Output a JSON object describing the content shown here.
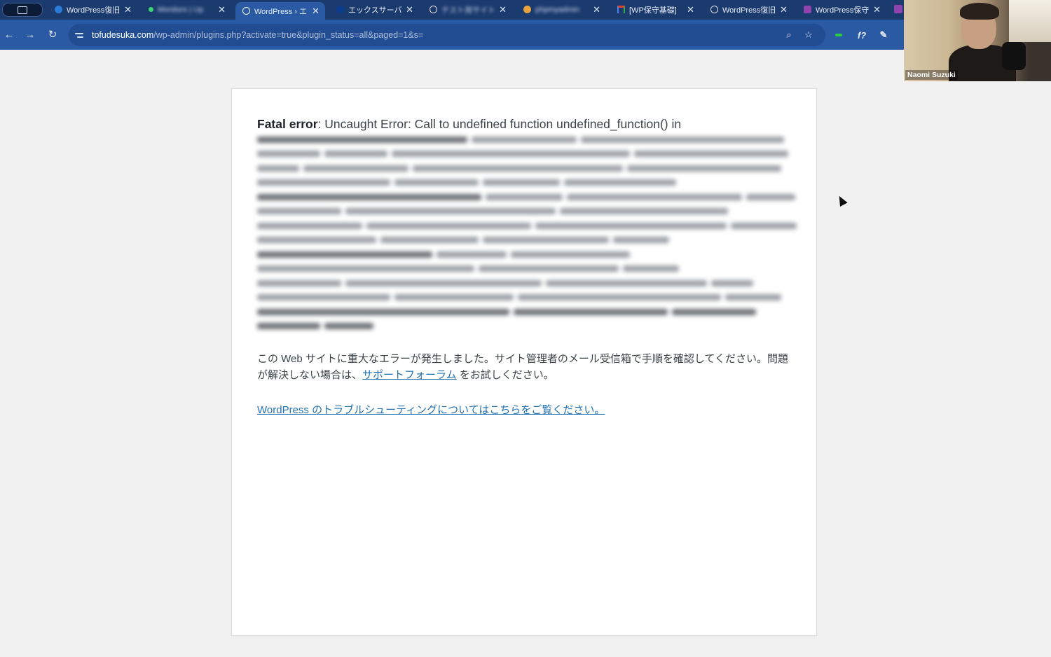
{
  "browser": {
    "tabs": [
      {
        "label": "WordPress復旧",
        "favicon": "wp-c-icon",
        "color": "#2b7bd8",
        "blurred": false,
        "active": false
      },
      {
        "label": "Monitors | Up",
        "favicon": "green-dot-icon",
        "color": "#3bd671",
        "blurred": true,
        "active": false
      },
      {
        "label": "WordPress › エ",
        "favicon": "wordpress-icon",
        "color": "#ffffff",
        "blurred": false,
        "active": true
      },
      {
        "label": "エックスサーバ",
        "favicon": "xserver-icon",
        "color": "#0d3b8c",
        "blurred": false,
        "active": false
      },
      {
        "label": "テスト用サイト",
        "favicon": "globe-icon",
        "color": "#dddddd",
        "blurred": true,
        "active": false
      },
      {
        "label": "phpmyadmin",
        "favicon": "phpmyadmin-icon",
        "color": "#e6a23c",
        "blurred": true,
        "active": false
      },
      {
        "label": "[WP保守基礎]",
        "favicon": "gmail-icon",
        "color": "#ea4335",
        "blurred": false,
        "active": false
      },
      {
        "label": "WordPress復旧",
        "favicon": "globe-icon",
        "color": "#dddddd",
        "blurred": false,
        "active": false
      },
      {
        "label": "WordPress保守",
        "favicon": "notion-list-icon",
        "color": "#8e44ad",
        "blurred": false,
        "active": false
      }
    ],
    "tab_close": "✕",
    "url_domain": "tofudesuka.com",
    "url_path": "/wp-admin/plugins.php?activate=true&plugin_status=all&paged=1&s=",
    "icons": {
      "back": "←",
      "forward": "→",
      "reload": "↻",
      "zoom": "⌕",
      "star": "☆",
      "ext": "f?",
      "pen": "✎"
    }
  },
  "video_overlay": {
    "participant_name": "Naomi Suzuki"
  },
  "error_page": {
    "fatal_label": "Fatal error",
    "fatal_message": ": Uncaught Error: Call to undefined function undefined_function() in",
    "message_before_link": "この Web サイトに重大なエラーが発生しました。サイト管理者のメール受信箱で手順を確認してください。問題が解決しない場合は、",
    "support_link": "サポートフォーラム",
    "message_after_link": " をお試しください。",
    "troubleshoot_link": "WordPress のトラブルシューティングについてはこちらをご覧ください。",
    "link_color": "#2271b1"
  }
}
